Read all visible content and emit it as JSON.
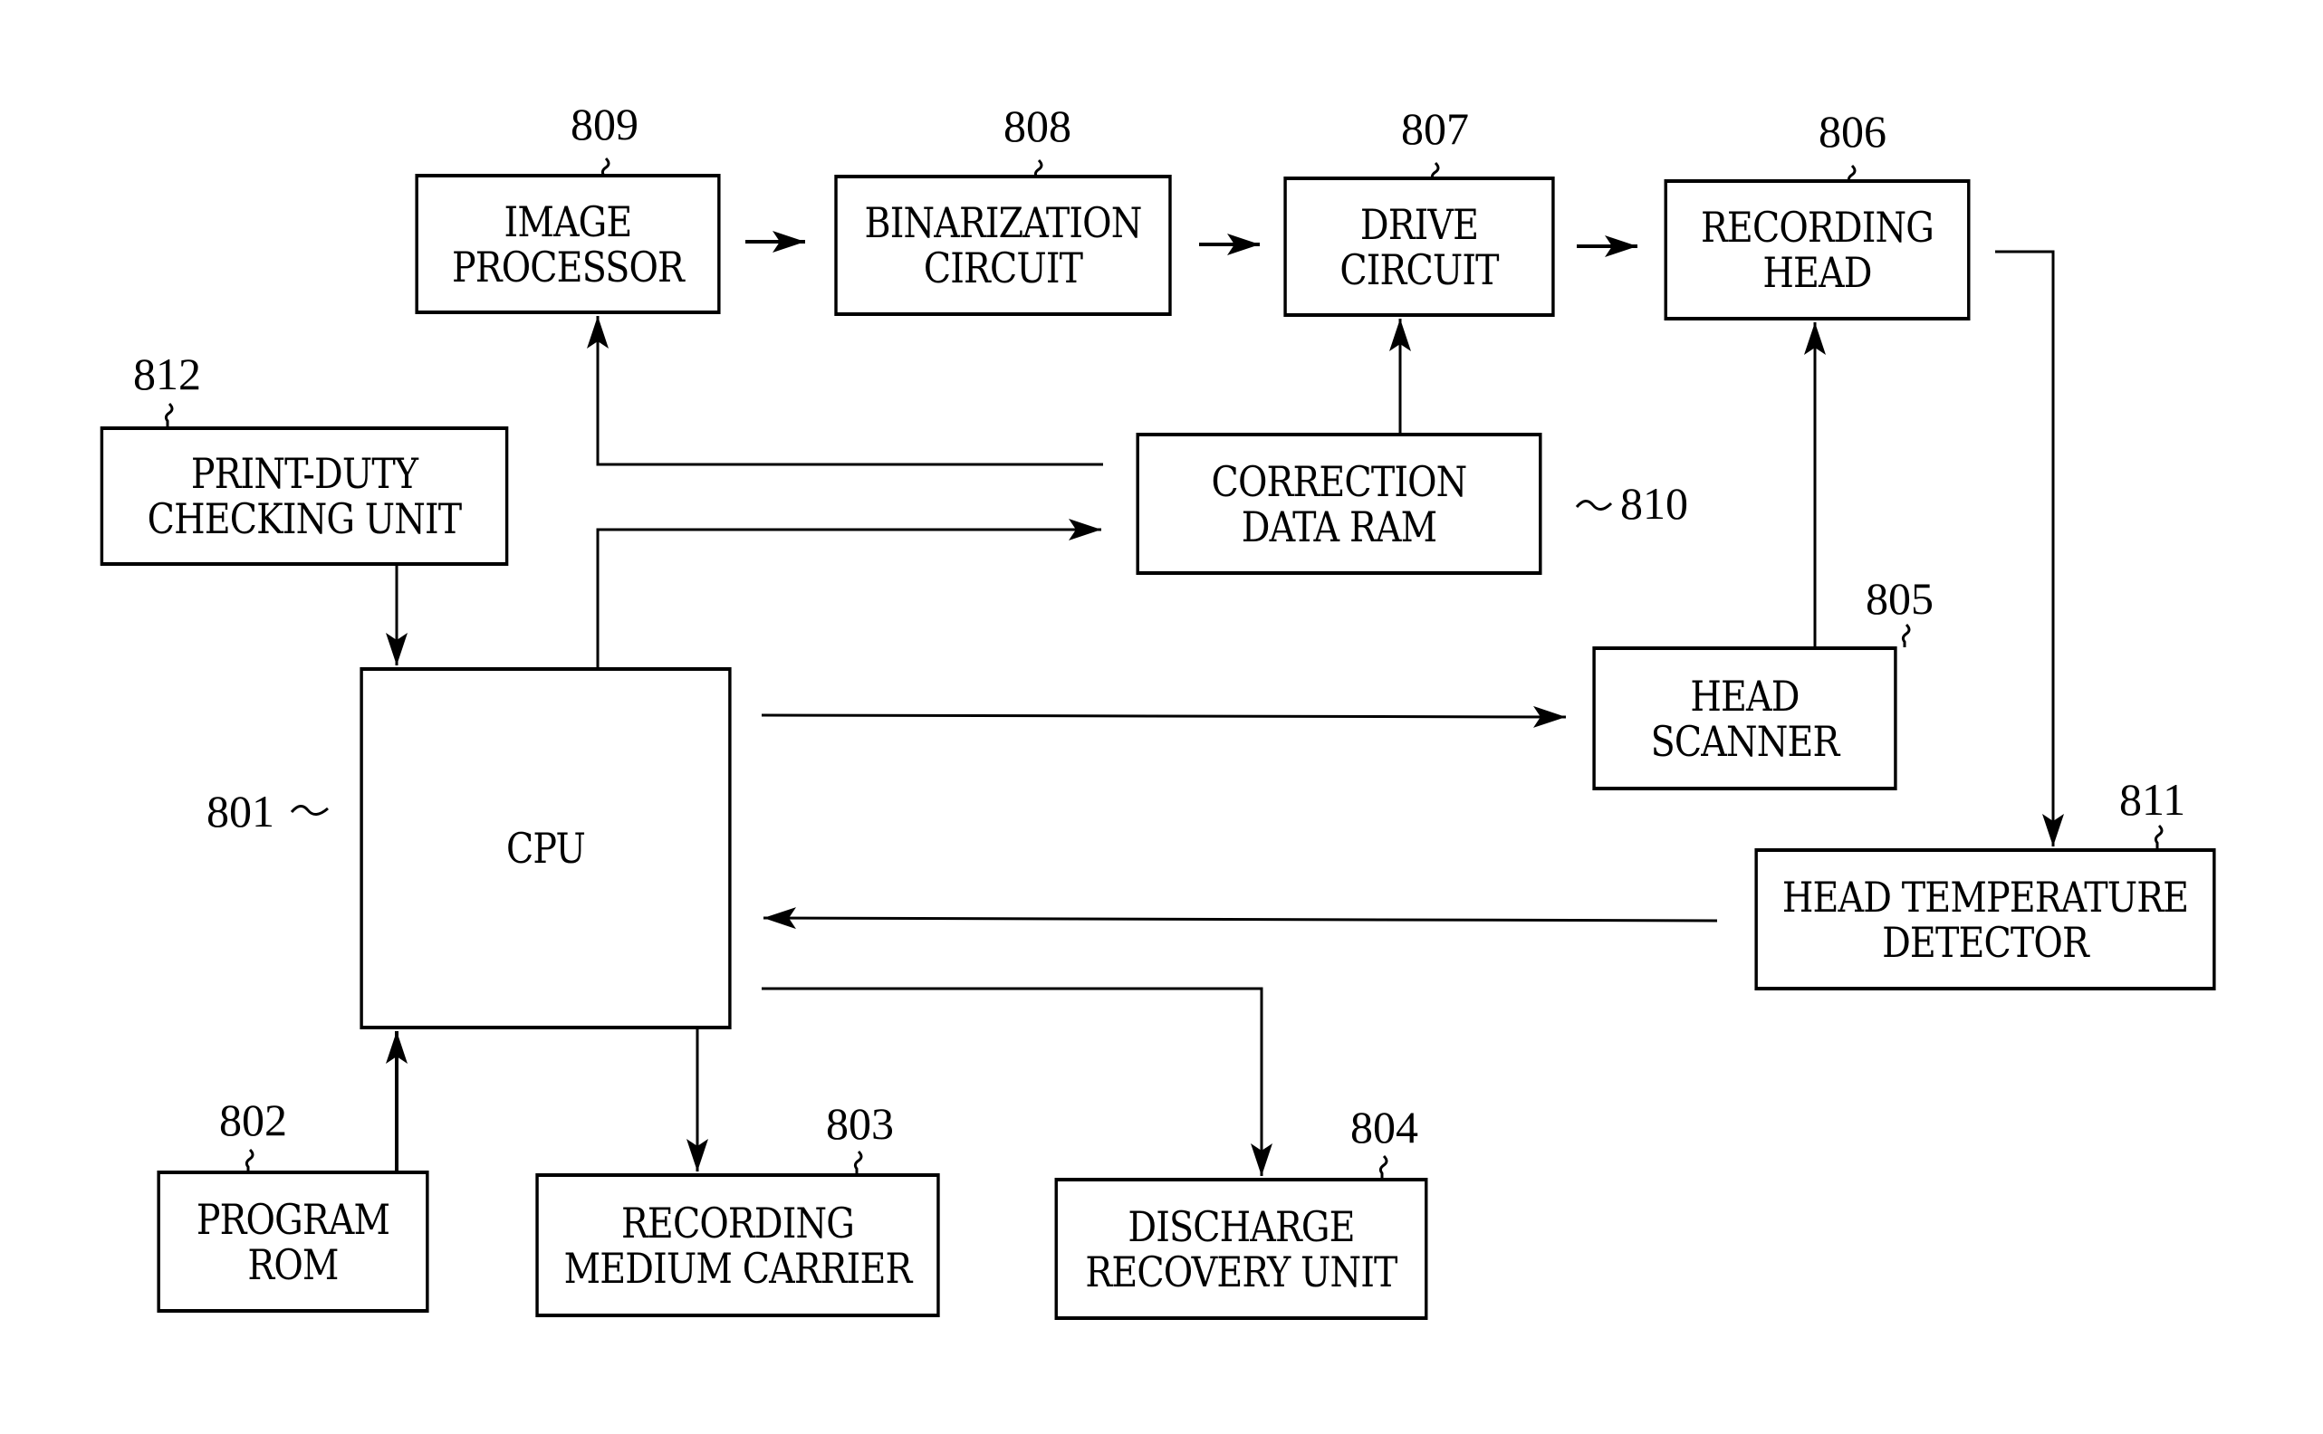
{
  "diagram": {
    "blocks": {
      "image_processor": {
        "ref": "809",
        "lines": [
          "IMAGE",
          "PROCESSOR"
        ]
      },
      "binarization_circuit": {
        "ref": "808",
        "lines": [
          "BINARIZATION",
          "CIRCUIT"
        ]
      },
      "drive_circuit": {
        "ref": "807",
        "lines": [
          "DRIVE",
          "CIRCUIT"
        ]
      },
      "recording_head": {
        "ref": "806",
        "lines": [
          "RECORDING",
          "HEAD"
        ]
      },
      "print_duty_checking_unit": {
        "ref": "812",
        "lines": [
          "PRINT-DUTY",
          "CHECKING UNIT"
        ]
      },
      "correction_data_ram": {
        "ref": "810",
        "lines": [
          "CORRECTION",
          "DATA RAM"
        ]
      },
      "cpu": {
        "ref": "801",
        "lines": [
          "CPU"
        ]
      },
      "head_scanner": {
        "ref": "805",
        "lines": [
          "HEAD",
          "SCANNER"
        ]
      },
      "head_temperature_detector": {
        "ref": "811",
        "lines": [
          "HEAD TEMPERATURE",
          "DETECTOR"
        ]
      },
      "program_rom": {
        "ref": "802",
        "lines": [
          "PROGRAM",
          "ROM"
        ]
      },
      "recording_medium_carrier": {
        "ref": "803",
        "lines": [
          "RECORDING",
          "MEDIUM CARRIER"
        ]
      },
      "discharge_recovery_unit": {
        "ref": "804",
        "lines": [
          "DISCHARGE",
          "RECOVERY UNIT"
        ]
      }
    },
    "connections": [
      {
        "from": "image_processor",
        "to": "binarization_circuit"
      },
      {
        "from": "binarization_circuit",
        "to": "drive_circuit"
      },
      {
        "from": "drive_circuit",
        "to": "recording_head"
      },
      {
        "from": "recording_head",
        "to": "head_temperature_detector"
      },
      {
        "from": "correction_data_ram",
        "to": "image_processor"
      },
      {
        "from": "correction_data_ram",
        "to": "drive_circuit"
      },
      {
        "from": "cpu",
        "to": "correction_data_ram"
      },
      {
        "from": "print_duty_checking_unit",
        "to": "cpu"
      },
      {
        "from": "cpu",
        "to": "head_scanner"
      },
      {
        "from": "head_scanner",
        "to": "recording_head"
      },
      {
        "from": "head_temperature_detector",
        "to": "cpu"
      },
      {
        "from": "program_rom",
        "to": "cpu"
      },
      {
        "from": "cpu",
        "to": "recording_medium_carrier"
      },
      {
        "from": "cpu",
        "to": "discharge_recovery_unit"
      }
    ]
  }
}
